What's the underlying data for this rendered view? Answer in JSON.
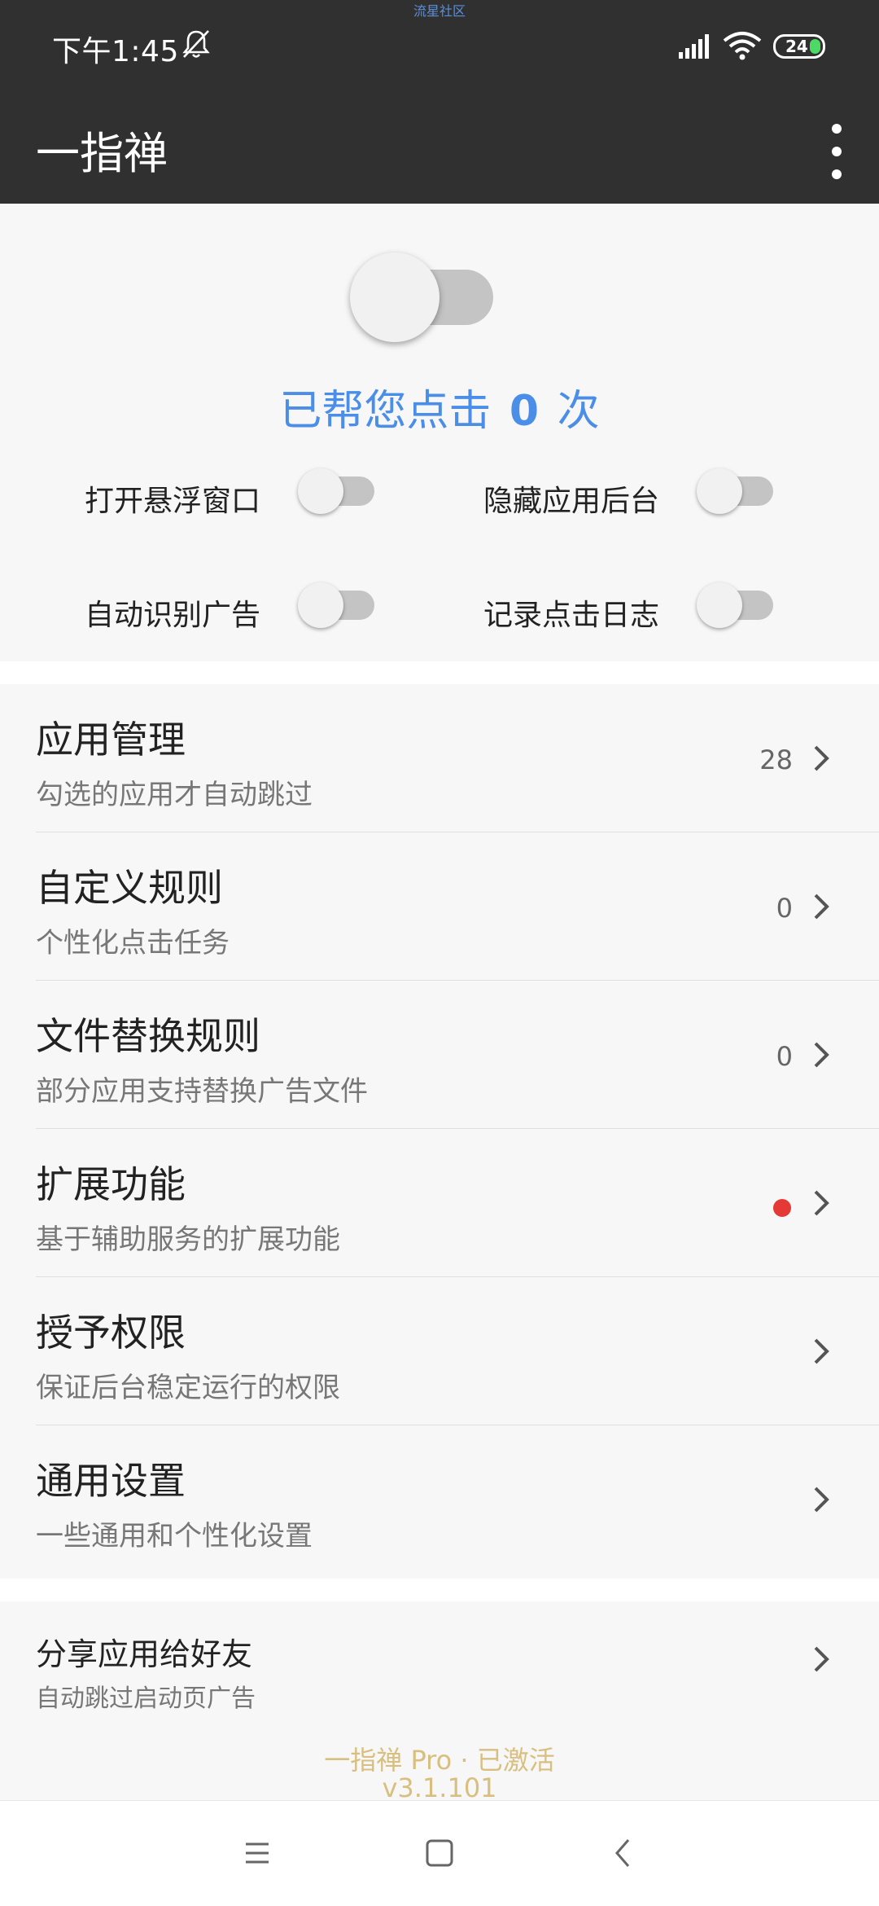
{
  "status_bar": {
    "time": "下午1:45",
    "watermark": "流星社区",
    "battery": "24",
    "icons": [
      "bell-off-icon",
      "signal-icon",
      "wifi-icon",
      "battery-icon"
    ]
  },
  "app_bar": {
    "title": "一指禅",
    "menu_icon": "more-vert-icon"
  },
  "main_switch": {
    "on": false
  },
  "counter": {
    "prefix": "已帮您点击",
    "count": "0",
    "suffix": "次",
    "color": "#4a8ee8"
  },
  "options": [
    {
      "label": "打开悬浮窗口",
      "on": false
    },
    {
      "label": "隐藏应用后台",
      "on": false
    },
    {
      "label": "自动识别广告",
      "on": false
    },
    {
      "label": "记录点击日志",
      "on": false
    }
  ],
  "menu": [
    {
      "title": "应用管理",
      "subtitle": "勾选的应用才自动跳过",
      "count": "28"
    },
    {
      "title": "自定义规则",
      "subtitle": "个性化点击任务",
      "count": "0"
    },
    {
      "title": "文件替换规则",
      "subtitle": "部分应用支持替换广告文件",
      "count": "0"
    },
    {
      "title": "扩展功能",
      "subtitle": "基于辅助服务的扩展功能",
      "badge": "red-dot",
      "badge_color": "#e53935"
    },
    {
      "title": "授予权限",
      "subtitle": "保证后台稳定运行的权限"
    },
    {
      "title": "通用设置",
      "subtitle": "一些通用和个性化设置"
    }
  ],
  "share": {
    "title": "分享应用给好友",
    "subtitle": "自动跳过启动页广告"
  },
  "footer": {
    "pro_status": "一指禅 Pro · 已激活",
    "version": "v3.1.101",
    "color": "#d9bf7f"
  },
  "nav_bar": {
    "icons": [
      "menu-icon",
      "home-icon",
      "back-icon"
    ]
  }
}
